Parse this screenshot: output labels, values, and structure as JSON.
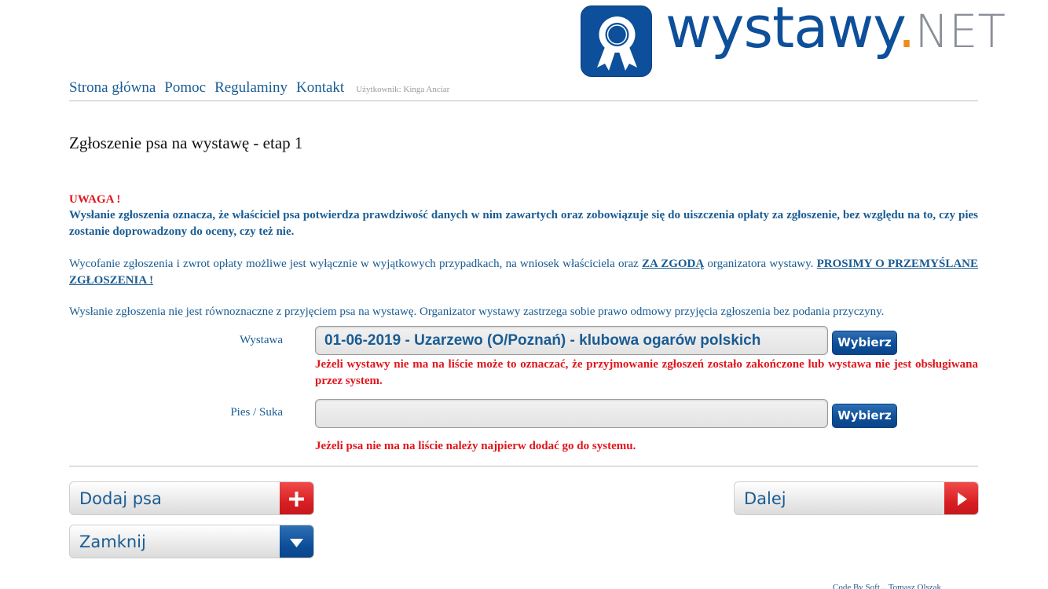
{
  "logo": {
    "word": "wystawy",
    "dot": ".",
    "net": "NET"
  },
  "nav": {
    "items": [
      "Strona główna",
      "Pomoc",
      "Regulaminy",
      "Kontakt"
    ],
    "user": "Użytkownik: Kinga Anciar"
  },
  "page_title": "Zgłoszenie psa na wystawę - etap 1",
  "notice": {
    "heading": "UWAGA !",
    "body": "Wysłanie zgłoszenia oznacza, że właściciel psa potwierdza prawdziwość danych w nim zawartych oraz zobowiązuje się do uiszczenia opłaty za zgłoszenie, bez względu na to, czy pies zostanie doprowadzony do oceny, czy też nie.",
    "para2_text1": "Wycofanie zgłoszenia i zwrot opłaty możliwe jest wyłącznie w wyjątkowych przypadkach, na wniosek właściciela oraz ",
    "para2_link1": "ZA ZGODĄ",
    "para2_text2": " organizatora wystawy. ",
    "para2_link2": "PROSIMY O PRZEMYŚLANE ZGŁOSZENIA !",
    "para3": "Wysłanie zgłoszenia nie jest równoznaczne z przyjęciem psa na wystawę. Organizator wystawy zastrzega sobie prawo odmowy przyjęcia zgłoszenia bez podania przyczyny."
  },
  "form": {
    "show_label": "Wystawa",
    "show_value": "01-06-2019 - Uzarzewo (O/Poznań) - klubowa ogarów polskich",
    "show_button": "Wybierz",
    "show_note": "Jeżeli wystawy nie ma na liście może to oznaczać, że przyjmowanie zgłoszeń zostało zakończone lub wystawa nie jest obsługiwana przez system.",
    "dog_label": "Pies / Suka",
    "dog_value": "",
    "dog_button": "Wybierz",
    "dog_note": "Jeżeli psa nie ma na liście należy najpierw dodać go do systemu."
  },
  "actions": {
    "add_dog": "Dodaj psa",
    "next": "Dalej",
    "close": "Zamknij"
  },
  "footer": "Code By Soft... Tomasz Olszak"
}
